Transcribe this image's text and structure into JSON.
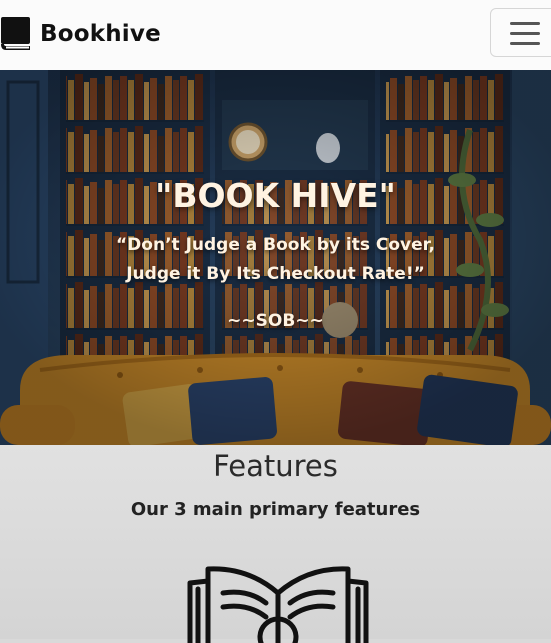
{
  "navbar": {
    "brand": "Bookhive",
    "brand_icon": "book-icon",
    "toggler_icon": "hamburger-menu-icon"
  },
  "hero": {
    "title": "\"BOOK HIVE\"",
    "quote": "“Don’t Judge a Book by its Cover, Judge it By Its Checkout Rate!”",
    "signature": "~~SOB~~"
  },
  "features": {
    "title": "Features",
    "subtitle": "Our 3 main primary features",
    "icon": "open-book-icon"
  },
  "colors": {
    "navbar_bg": "#fbfbfb",
    "hero_text": "#fff3e2",
    "features_bg": "#dcdcdc"
  }
}
